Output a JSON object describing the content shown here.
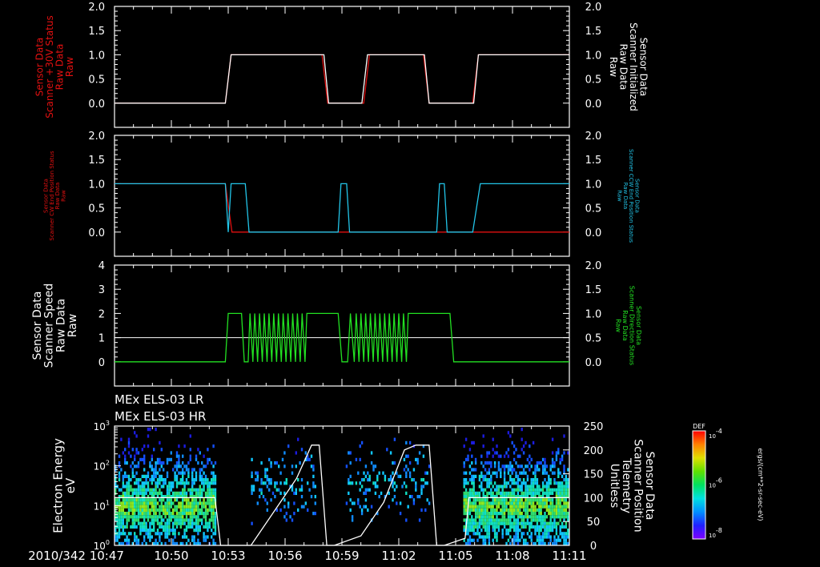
{
  "colors": {
    "background": "#000000",
    "axis": "#ffffff",
    "red": "#e01010",
    "cyan": "#22c4e8",
    "green": "#22e022",
    "white": "#ffffff"
  },
  "time_ticks": [
    "10:47",
    "10:50",
    "10:53",
    "10:56",
    "10:59",
    "11:02",
    "11:05",
    "11:08",
    "11:11"
  ],
  "date_prefix": "2010/342",
  "time_range_minutes": [
    0,
    24
  ],
  "chart_data": [
    {
      "type": "line",
      "panel": "scanner-30v-status",
      "ylabel_left": [
        "Sensor Data",
        "Scanner +30V Status",
        "Raw Data",
        "Raw"
      ],
      "ylabel_right": [
        "Sensor Data",
        "Scanner Initialized",
        "Raw Data",
        "Raw"
      ],
      "ylim_left": [
        -0.5,
        2.0
      ],
      "ylim_right": [
        -0.5,
        2.0
      ],
      "left_ticks": [
        "0.0",
        "0.5",
        "1.0",
        "1.5",
        "2.0"
      ],
      "right_ticks": [
        "0.0",
        "0.5",
        "1.0",
        "1.5",
        "2.0"
      ],
      "series": [
        {
          "axis": "left",
          "color": "#e01010",
          "x": [
            0,
            5.85,
            6.15,
            10.95,
            11.25,
            13.15,
            13.45,
            16.3,
            16.6,
            18.9,
            19.2,
            24
          ],
          "y": [
            0,
            0,
            1,
            1,
            0,
            0,
            1,
            1,
            0,
            0,
            1,
            1
          ]
        },
        {
          "axis": "right",
          "color": "#ffffff",
          "x": [
            0,
            5.85,
            6.15,
            11.05,
            11.3,
            13.05,
            13.35,
            16.35,
            16.6,
            18.95,
            19.2,
            24
          ],
          "y": [
            0,
            0,
            1,
            1,
            0,
            0,
            1,
            1,
            0,
            0,
            1,
            1
          ]
        }
      ]
    },
    {
      "type": "line",
      "panel": "scanner-end-position",
      "ylabel_left": [
        "Sensor Data",
        "Scanner CW End Position Status",
        "Raw Data",
        "Raw"
      ],
      "ylabel_right": [
        "Sensor Data",
        "Scanner CCW End Position Status",
        "Raw Data",
        "Raw"
      ],
      "ylim_left": [
        -0.5,
        2.0
      ],
      "ylim_right": [
        -0.5,
        2.0
      ],
      "left_ticks": [
        "0.0",
        "0.5",
        "1.0",
        "1.5",
        "2.0"
      ],
      "right_ticks": [
        "0.0",
        "0.5",
        "1.0",
        "1.5",
        "2.0"
      ],
      "series": [
        {
          "axis": "left",
          "color": "#e01010",
          "x": [
            0,
            5.85,
            6.2,
            24
          ],
          "y": [
            1,
            1,
            0,
            0
          ]
        },
        {
          "axis": "right",
          "color": "#22c4e8",
          "x": [
            0,
            5.85,
            6.0,
            6.15,
            6.3,
            6.9,
            7.1,
            11.8,
            11.95,
            12.25,
            12.4,
            17.0,
            17.15,
            17.4,
            17.55,
            18.9,
            19.3,
            24
          ],
          "y": [
            1,
            1,
            0,
            1,
            1,
            1,
            0,
            0,
            1,
            1,
            0,
            0,
            1,
            1,
            0,
            0,
            1,
            1
          ]
        }
      ]
    },
    {
      "type": "line",
      "panel": "scanner-speed",
      "ylabel_left": [
        "Sensor Data",
        "Scanner Speed",
        "Raw Data",
        "Raw"
      ],
      "ylabel_right": [
        "Sensor Data",
        "Scanner Direction Status",
        "Raw Data",
        "Raw"
      ],
      "ylim_left": [
        -1,
        4
      ],
      "ylim_right": [
        -0.5,
        2.0
      ],
      "left_ticks": [
        "0",
        "1",
        "2",
        "3",
        "4"
      ],
      "right_ticks": [
        "0.0",
        "0.5",
        "1.0",
        "1.5",
        "2.0"
      ],
      "reference_line": {
        "axis": "left",
        "y": 1
      },
      "series": [
        {
          "axis": "right",
          "color": "#22e022",
          "x": [
            0,
            5.85,
            6.0,
            6.7,
            6.85,
            7.05,
            7.15,
            7.3,
            7.4,
            7.55,
            7.65,
            7.8,
            7.9,
            8.05,
            8.15,
            8.3,
            8.4,
            8.55,
            8.65,
            8.8,
            8.9,
            9.05,
            9.15,
            9.3,
            9.4,
            9.55,
            9.65,
            9.8,
            9.9,
            10.05,
            10.15,
            11.8,
            12.0,
            12.3,
            12.45,
            12.65,
            12.75,
            12.9,
            13.0,
            13.15,
            13.25,
            13.4,
            13.5,
            13.65,
            13.75,
            13.9,
            14.0,
            14.15,
            14.25,
            14.4,
            14.5,
            14.65,
            14.75,
            14.9,
            15.0,
            15.15,
            15.25,
            15.4,
            15.5,
            17.7,
            17.9,
            24
          ],
          "y": [
            0,
            0,
            1,
            1,
            0,
            0,
            1,
            0,
            1,
            0,
            1,
            0,
            1,
            0,
            1,
            0,
            1,
            0,
            1,
            0,
            1,
            0,
            1,
            0,
            1,
            0,
            1,
            0,
            1,
            0,
            1,
            1,
            0,
            0,
            1,
            0,
            1,
            0,
            1,
            0,
            1,
            0,
            1,
            0,
            1,
            0,
            1,
            0,
            1,
            0,
            1,
            0,
            1,
            0,
            1,
            0,
            1,
            0,
            1,
            1,
            0,
            0
          ]
        }
      ]
    },
    {
      "type": "heatmap",
      "panel": "electron-spectrogram",
      "title_lines": [
        "MEx ELS-03 LR",
        "MEx ELS-03 HR"
      ],
      "ylabel_left": [
        "Electron Energy",
        "eV"
      ],
      "ylabel_right": [
        "Sensor Data",
        "Scanner Position",
        "Telemetry",
        "Unitless"
      ],
      "ylim_left_log10": [
        0,
        3
      ],
      "ylim_right": [
        0,
        250
      ],
      "left_ticks": [
        "10^0",
        "10^1",
        "10^2",
        "10^3"
      ],
      "right_ticks": [
        "0",
        "50",
        "100",
        "150",
        "200",
        "250"
      ],
      "colorbar": {
        "label": "DEF",
        "unit": "ergs/(cm**2-sr-sec-eV)",
        "ticks": [
          "10^-4",
          "10^-6",
          "10^-8"
        ]
      },
      "scanner_position": {
        "x": [
          0,
          5.3,
          5.6,
          7.2,
          9.6,
          10.4,
          10.8,
          11.2,
          11.6,
          13.0,
          14.2,
          15.3,
          15.9,
          16.6,
          17.0,
          17.4,
          18.5,
          18.7,
          24
        ],
        "y": [
          100,
          100,
          0,
          0,
          140,
          210,
          210,
          0,
          0,
          20,
          90,
          200,
          210,
          210,
          0,
          0,
          15,
          100,
          100
        ]
      }
    }
  ]
}
